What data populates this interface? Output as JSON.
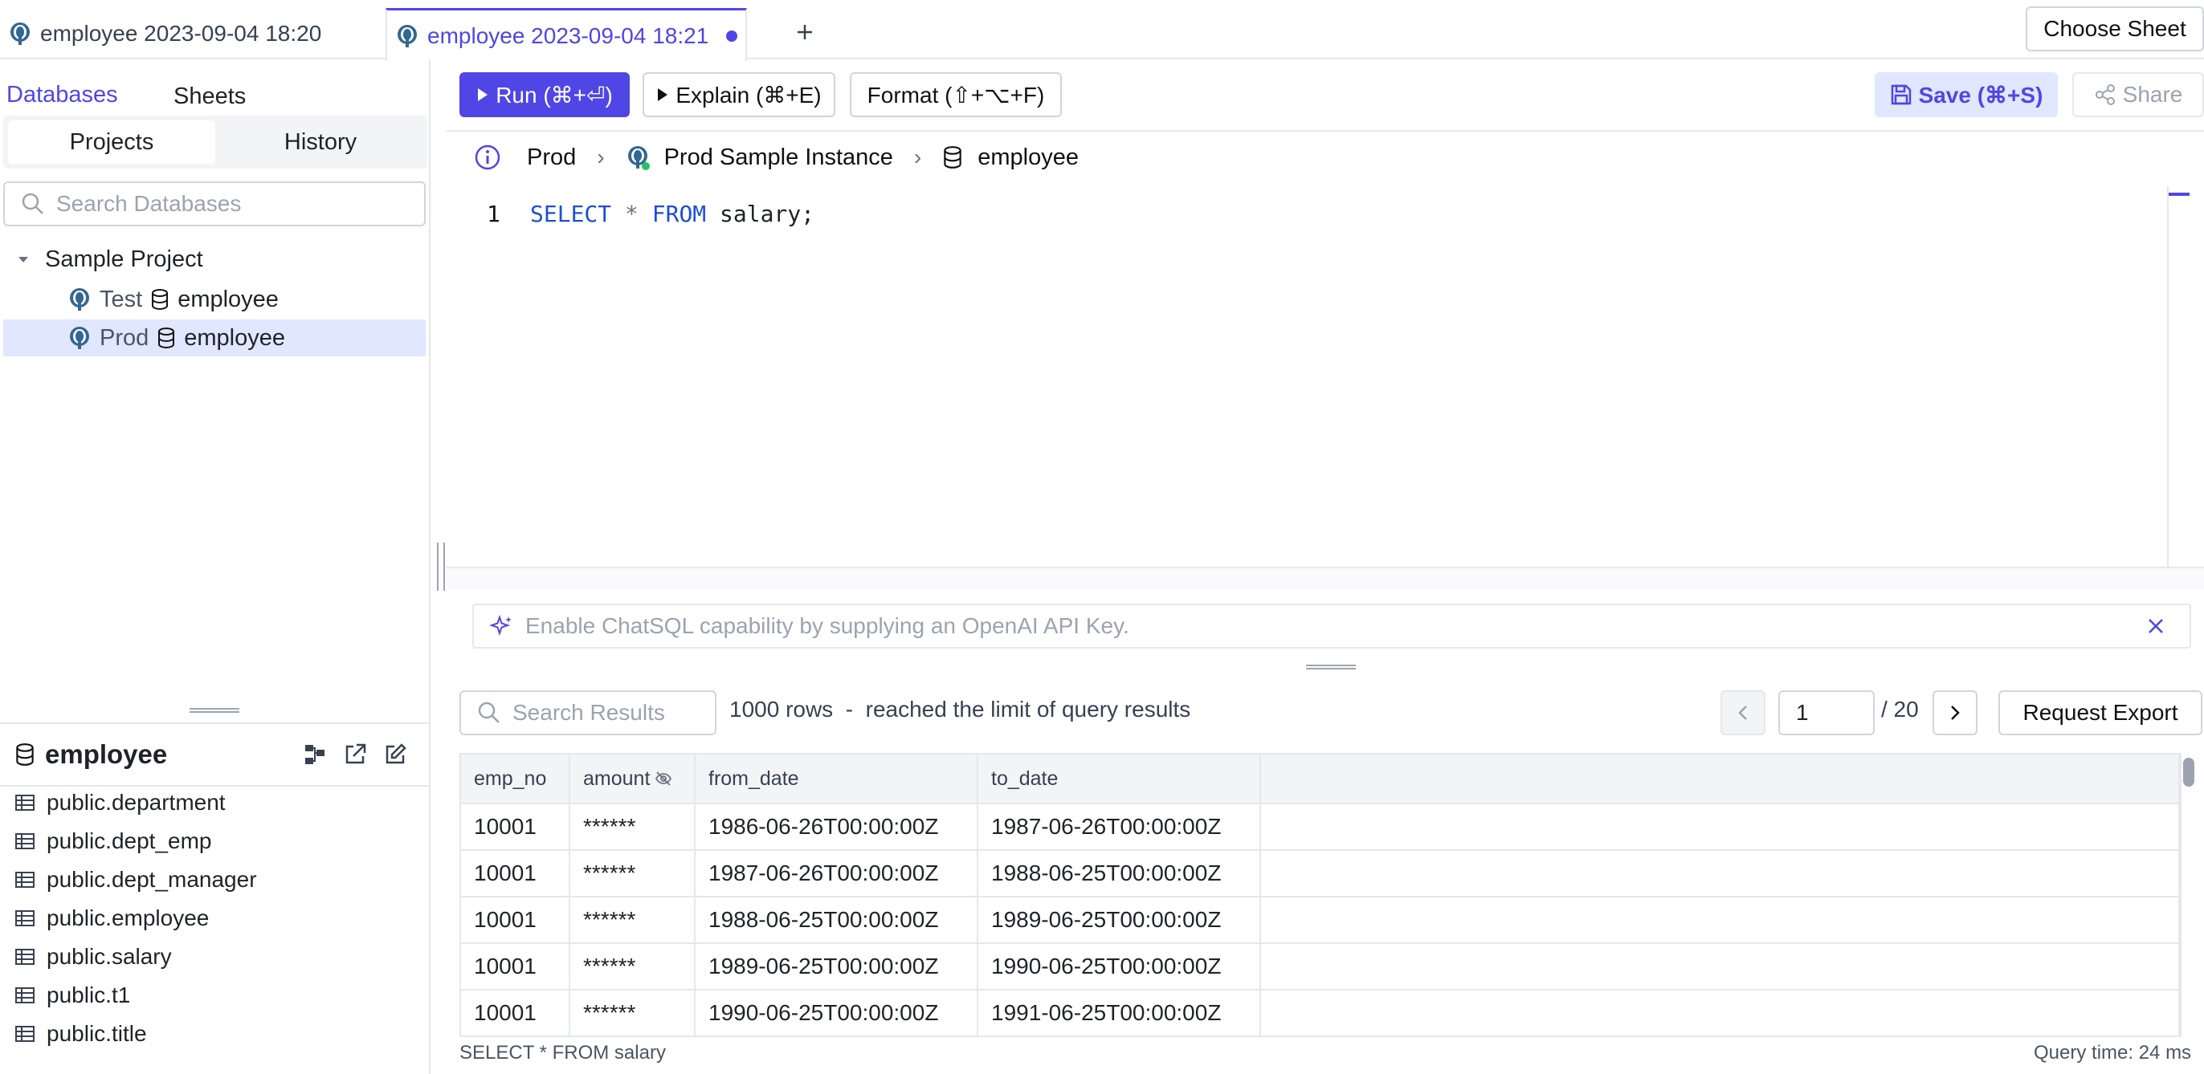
{
  "tabs": [
    {
      "label": "employee 2023-09-04 18:20",
      "active": false
    },
    {
      "label": "employee 2023-09-04 18:21",
      "active": true,
      "unsaved": true
    }
  ],
  "choose_sheet": "Choose Sheet",
  "sidebar": {
    "tabs": [
      "Databases",
      "Sheets"
    ],
    "segments": [
      "Projects",
      "History"
    ],
    "search_placeholder": "Search Databases",
    "project": "Sample Project",
    "items": [
      {
        "env": "Test",
        "db": "employee"
      },
      {
        "env": "Prod",
        "db": "employee",
        "selected": true
      }
    ],
    "database": {
      "name": "employee",
      "tables": [
        "public.department",
        "public.dept_emp",
        "public.dept_manager",
        "public.employee",
        "public.salary",
        "public.t1",
        "public.title"
      ]
    }
  },
  "toolbar": {
    "run": "Run (⌘+⏎)",
    "explain": "Explain (⌘+E)",
    "format": "Format (⇧+⌥+F)",
    "save": "Save (⌘+S)",
    "share": "Share"
  },
  "breadcrumb": {
    "environment": "Prod",
    "instance": "Prod Sample Instance",
    "database": "employee"
  },
  "editor": {
    "line_number": "1",
    "kw1": "SELECT",
    "star": "*",
    "kw2": "FROM",
    "rest": "salary;"
  },
  "chatsql": "Enable ChatSQL capability by supplying an OpenAI API Key.",
  "results": {
    "search_placeholder": "Search Results",
    "rows_info": "1000 rows  -  reached the limit of query results",
    "page": "1",
    "total_pages": "/ 20",
    "export": "Request Export",
    "columns": [
      "emp_no",
      "amount",
      "from_date",
      "to_date"
    ],
    "rows": [
      [
        "10001",
        "******",
        "1986-06-26T00:00:00Z",
        "1987-06-26T00:00:00Z"
      ],
      [
        "10001",
        "******",
        "1987-06-26T00:00:00Z",
        "1988-06-25T00:00:00Z"
      ],
      [
        "10001",
        "******",
        "1988-06-25T00:00:00Z",
        "1989-06-25T00:00:00Z"
      ],
      [
        "10001",
        "******",
        "1989-06-25T00:00:00Z",
        "1990-06-25T00:00:00Z"
      ],
      [
        "10001",
        "******",
        "1990-06-25T00:00:00Z",
        "1991-06-25T00:00:00Z"
      ]
    ]
  },
  "status": {
    "statement": "SELECT * FROM salary",
    "query_time": "Query time: 24 ms"
  },
  "colors": {
    "accent": "#4f46e5",
    "selected_row": "#e0e7ff"
  }
}
